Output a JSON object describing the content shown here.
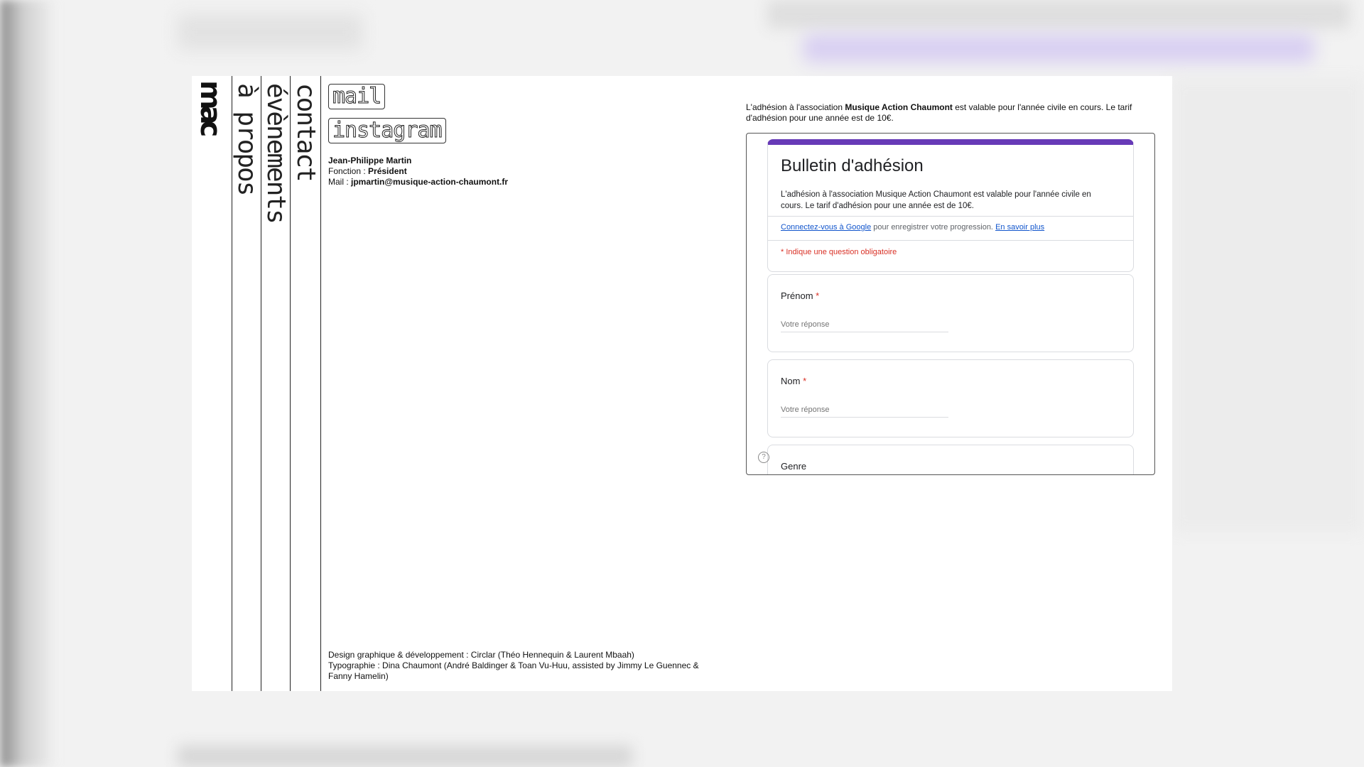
{
  "nav": {
    "logo": "mac",
    "items": [
      {
        "label": "à propos"
      },
      {
        "label": "évènements"
      },
      {
        "label": "contact"
      }
    ]
  },
  "contact": {
    "mail_link": "mail",
    "instagram_link": "instagram",
    "person_name": "Jean-Philippe Martin",
    "role_label": "Fonction : ",
    "role_value": "Président",
    "mail_label": "Mail : ",
    "mail_value": "jpmartin@musique-action-chaumont.fr"
  },
  "credits": {
    "design": "Design graphique & développement : Circlar (Théo Hennequin & Laurent Mbaah)",
    "typo": "Typographie : Dina Chaumont (André Baldinger & Toan Vu-Huu, assisted by Jimmy Le Guennec & Fanny Hamelin)"
  },
  "intro": {
    "before": "L'adhésion à l'association ",
    "bold": "Musique Action Chaumont",
    "after": " est valable pour l'année civile en cours. Le tarif d'adhésion pour une année est de 10€."
  },
  "form": {
    "accent_color": "#673ab7",
    "title": "Bulletin d'adhésion",
    "description": "L'adhésion à l'association Musique Action Chaumont est valable pour l'année civile en cours. Le tarif d'adhésion pour une année est de 10€.",
    "signin_link": "Connectez-vous à Google",
    "signin_text": " pour enregistrer votre progression. ",
    "learn_more": "En savoir plus",
    "required_note": "* Indique une question obligatoire",
    "questions": [
      {
        "label": "Prénom",
        "required": "*",
        "placeholder": "Votre réponse"
      },
      {
        "label": "Nom",
        "required": "*",
        "placeholder": "Votre réponse"
      },
      {
        "label": "Genre"
      }
    ],
    "help_icon": "?"
  }
}
